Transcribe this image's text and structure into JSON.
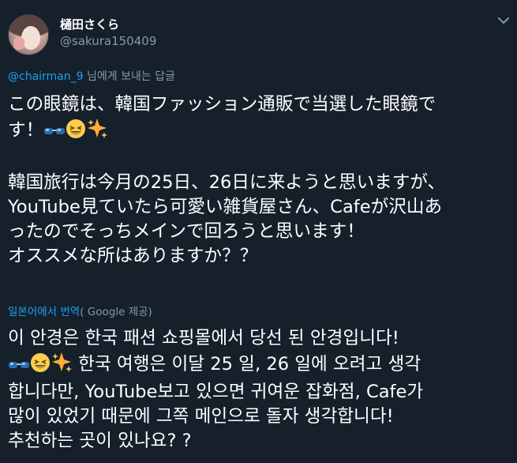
{
  "user": {
    "display_name": "樋田さくら",
    "handle": "@sakura150409"
  },
  "reply": {
    "mention": "@chairman_9",
    "suffix": " 님에게 보내는 답글"
  },
  "tweet": {
    "line1": "この眼鏡は、韓国ファッション通販で当選した眼鏡で",
    "line2": "す！",
    "line3": "韓国旅行は今月の25日、26日に来ようと思いますが、",
    "line4": "YouTube見ていたら可愛い雑貨屋さん、Cafeが沢山あ",
    "line5": "ったのでそっちメインで回ろうと思います！",
    "line6": "オススメな所はありますか？？"
  },
  "translation": {
    "link": "일본어에서 번역",
    "provider": "( Google 제공)"
  },
  "translated": {
    "line1": "이 안경은 한국 패션 쇼핑몰에서 당선 된 안경입니다!",
    "line2": " 한국 여행은 이달 25 일, 26 일에 오려고 생각",
    "line3": "합니다만, YouTube보고 있으면 귀여운 잡화점, Cafe가",
    "line4": "많이 있었기 때문에 그쪽 메인으로 돌자 생각합니다!",
    "line5": "추천하는 곳이 있나요? ?"
  },
  "icons": [
    "sunglasses-icon",
    "grin-sweat-icon",
    "sparkles-icon",
    "chevron-down-icon"
  ],
  "colors": {
    "background": "#15202b",
    "text": "#ffffff",
    "muted": "#8899a6",
    "accent": "#1da1f2"
  }
}
